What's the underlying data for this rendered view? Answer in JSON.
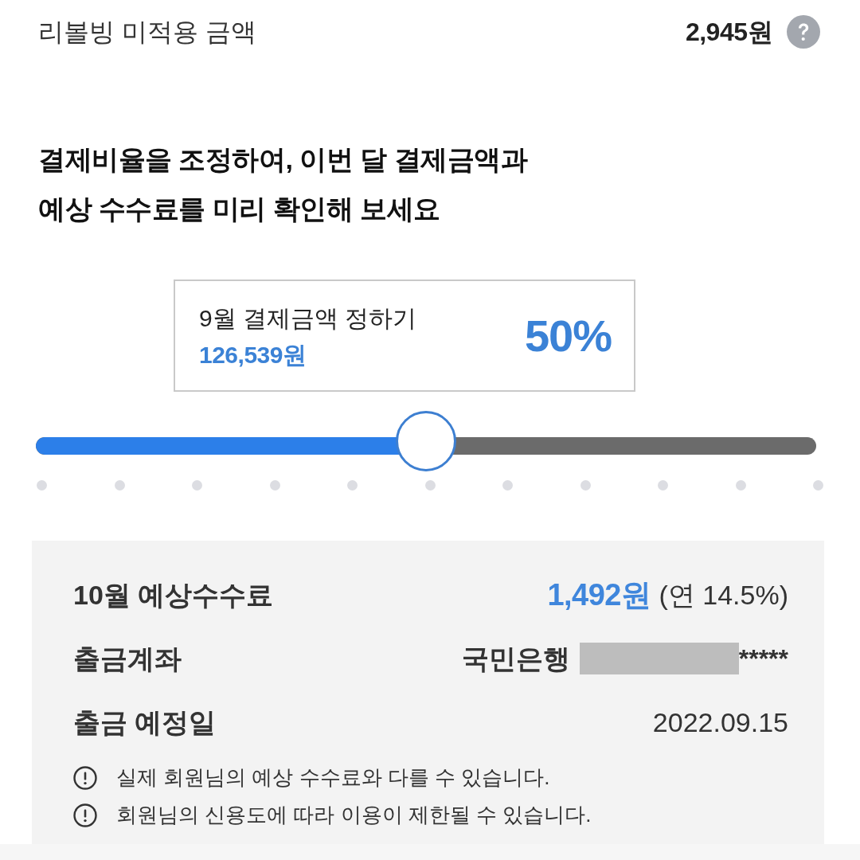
{
  "summary": {
    "label": "리볼빙 미적용 금액",
    "amount": "2,945원"
  },
  "heading": "결제비율을 조정하여, 이번 달 결제금액과\n예상 수수료를 미리 확인해 보세요",
  "payment_box": {
    "title": "9월 결제금액 정하기",
    "amount": "126,539원",
    "percent": "50%"
  },
  "slider": {
    "level": 0.5
  },
  "details": {
    "rows": [
      {
        "kind": "fee",
        "label": "10월 예상수수료",
        "value": "1,492원",
        "note": "(연 14.5%)"
      },
      {
        "kind": "account",
        "label": "출금계좌",
        "bank": "국민은행",
        "account_suffix": "*****"
      },
      {
        "kind": "date",
        "label": "출금 예정일",
        "value": "2022.09.15"
      }
    ],
    "notices": [
      "실제 회원님의 예상 수수료와 다를 수 있습니다.",
      "회원님의 신용도에 따라 이용이 제한될 수 있습니다."
    ]
  }
}
